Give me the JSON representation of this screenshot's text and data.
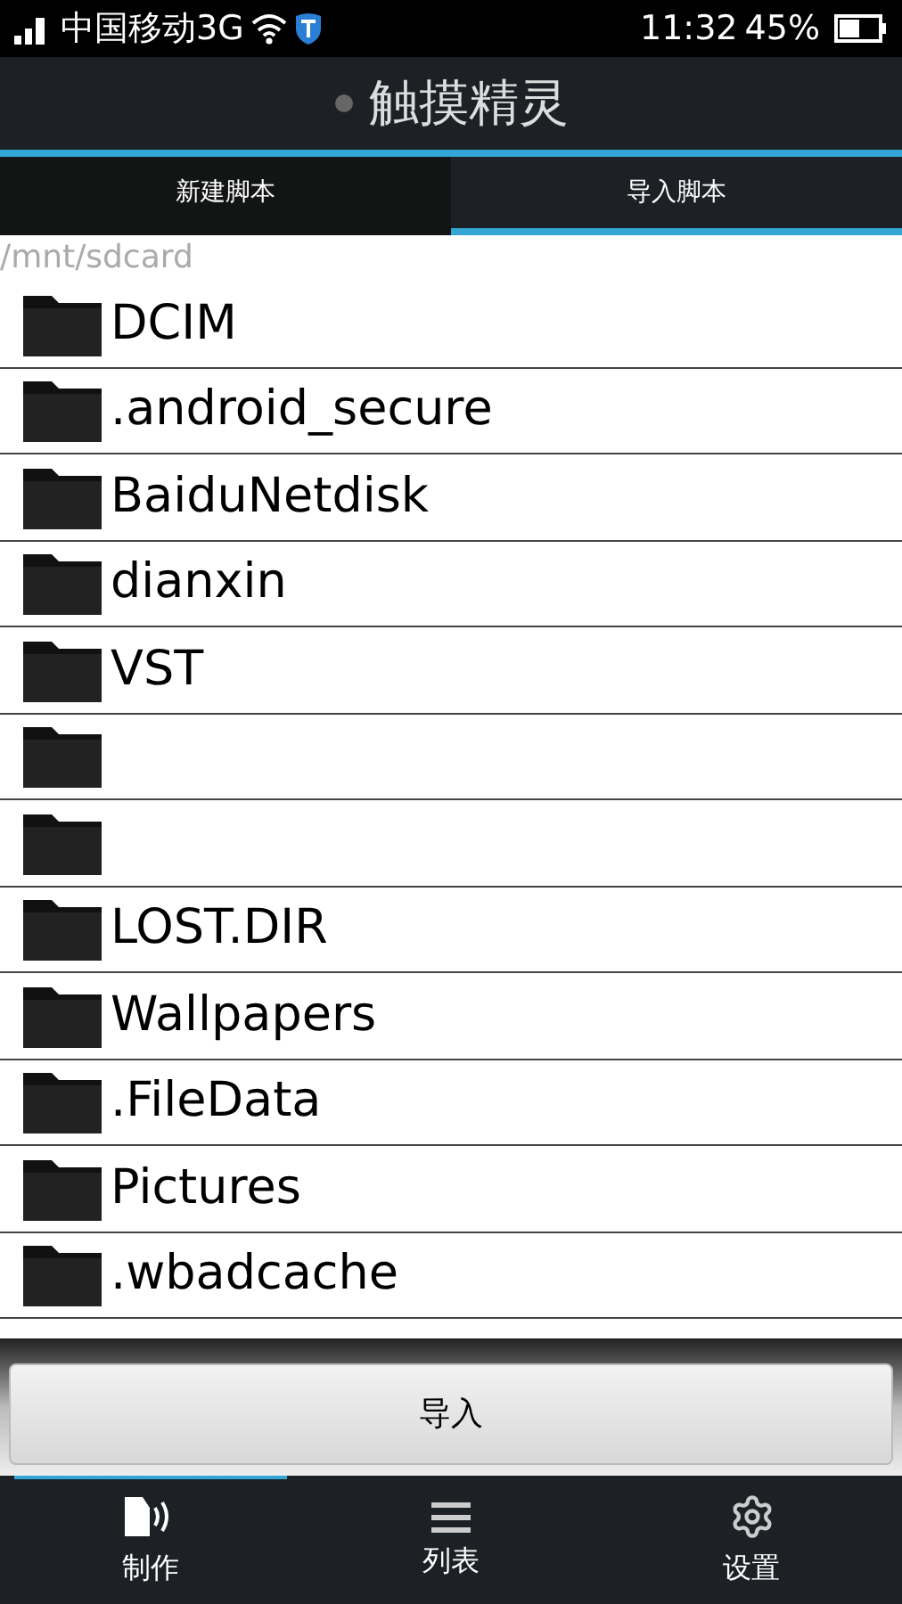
{
  "status_bar": {
    "carrier": "中国移动3G",
    "time": "11:32",
    "battery": "45%"
  },
  "app_bar": {
    "title": "触摸精灵"
  },
  "tabs": [
    {
      "label": "新建脚本",
      "selected": false
    },
    {
      "label": "导入脚本",
      "selected": true
    }
  ],
  "path": "/mnt/sdcard",
  "files": [
    {
      "kind": "folder",
      "name": "DCIM"
    },
    {
      "kind": "folder",
      "name": ".android_secure"
    },
    {
      "kind": "folder",
      "name": "BaiduNetdisk"
    },
    {
      "kind": "folder",
      "name": "dianxin"
    },
    {
      "kind": "folder",
      "name": "VST"
    },
    {
      "kind": "folder"
    },
    {
      "kind": "folder"
    },
    {
      "kind": "folder",
      "name": "LOST.DIR"
    },
    {
      "kind": "folder",
      "name": "Wallpapers"
    },
    {
      "kind": "folder",
      "name": ".FileData"
    },
    {
      "kind": "folder",
      "name": "Pictures"
    },
    {
      "kind": "folder",
      "name": ".wbadcache"
    }
  ],
  "import_button": "导入",
  "bottom_nav": [
    {
      "label": "制作",
      "kind": "make",
      "selected": true
    },
    {
      "label": "列表",
      "kind": "list",
      "selected": false
    },
    {
      "label": "设置",
      "kind": "settings",
      "selected": false
    }
  ]
}
